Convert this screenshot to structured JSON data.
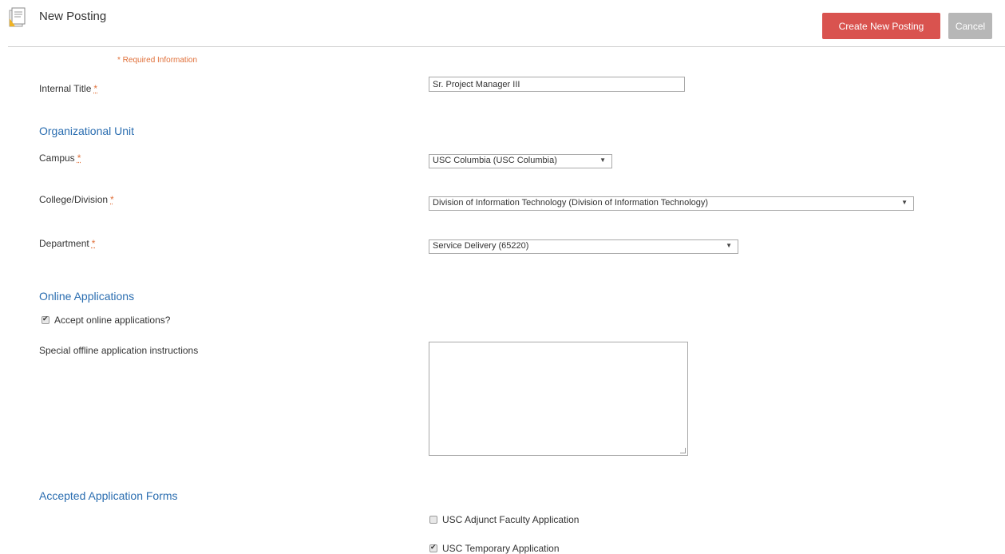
{
  "header": {
    "title": "New Posting",
    "icon": "document-icon",
    "create_label": "Create New Posting",
    "cancel_label": "Cancel",
    "create_color": "#d9534f",
    "cancel_color": "#b7b7b7"
  },
  "form": {
    "required_note": "* Required Information",
    "required_marker": "*",
    "internal_title": {
      "label": "Internal Title",
      "value": "Sr. Project Manager III"
    },
    "org_section": "Organizational Unit",
    "campus": {
      "label": "Campus",
      "value": "USC Columbia (USC Columbia)"
    },
    "college": {
      "label": "College/Division",
      "value": "Division of Information Technology (Division of Information Technology)"
    },
    "department": {
      "label": "Department",
      "value": "Service Delivery (65220)"
    },
    "online_section": "Online Applications",
    "accept_online": {
      "label": "Accept online applications?",
      "checked": true
    },
    "special_instructions": {
      "label": "Special offline application instructions",
      "value": ""
    },
    "forms_section": "Accepted Application Forms",
    "forms": [
      {
        "label": "USC Adjunct Faculty Application",
        "checked": false
      },
      {
        "label": "USC Temporary Application",
        "checked": true
      }
    ]
  },
  "colors": {
    "section_heading": "#2a6db0",
    "required": "#e0703a"
  }
}
